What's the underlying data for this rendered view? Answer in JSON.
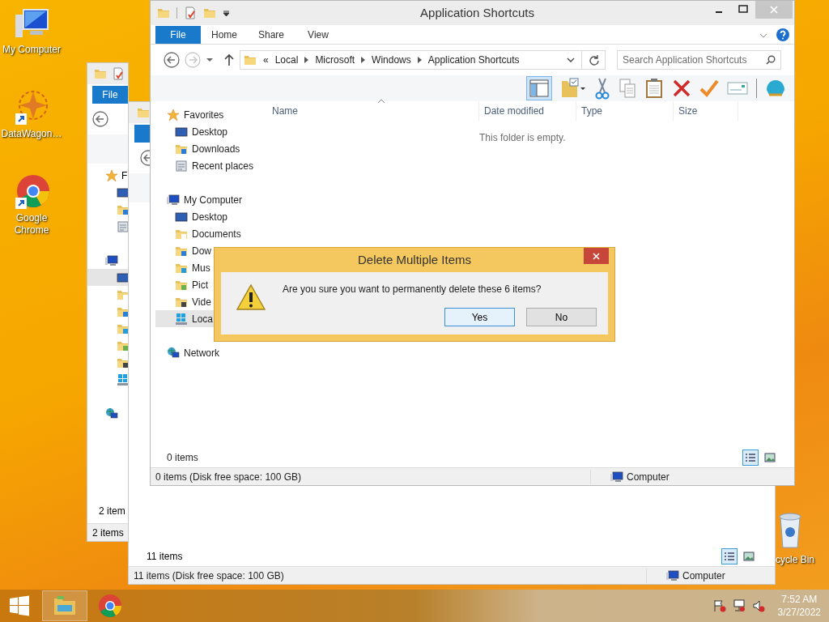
{
  "desktop_icons": [
    {
      "label": "My Computer",
      "kind": "computer"
    },
    {
      "label": "DataWagon…",
      "kind": "app"
    },
    {
      "label": "Google Chrome",
      "kind": "chrome"
    },
    {
      "label": "cycle Bin",
      "kind": "recycle"
    }
  ],
  "back_window": {
    "file_tab": "File",
    "sidebar": [
      {
        "kind": "star",
        "label": "F",
        "selected": false
      },
      {
        "kind": "desktop",
        "selected": false
      },
      {
        "kind": "download",
        "selected": false
      },
      {
        "kind": "recent",
        "selected": false
      },
      {
        "kind": "computer",
        "selected": false
      },
      {
        "kind": "desktop",
        "selected": true
      },
      {
        "kind": "documents",
        "selected": false
      },
      {
        "kind": "download",
        "selected": false
      },
      {
        "kind": "music",
        "selected": false
      },
      {
        "kind": "pictures",
        "selected": false
      },
      {
        "kind": "videos",
        "selected": false
      },
      {
        "kind": "drive",
        "selected": false
      },
      {
        "kind": "network",
        "selected": false
      }
    ],
    "item_count": "2 item",
    "status": "2 items"
  },
  "middle_window": {
    "item_count": "11 items",
    "status": "11 items (Disk free space: 100 GB)",
    "location": "Computer",
    "views": [
      {
        "kind": "details",
        "selected": true
      },
      {
        "kind": "tiles",
        "selected": false
      }
    ]
  },
  "explorer": {
    "title": "Application Shortcuts",
    "tabs": [
      {
        "label": "File",
        "selected": true
      },
      {
        "label": "Home",
        "selected": false
      },
      {
        "label": "Share",
        "selected": false
      },
      {
        "label": "View",
        "selected": false
      }
    ],
    "address": {
      "overflow_mark": "«",
      "crumbs": [
        "Local",
        "Microsoft",
        "Windows",
        "Application Shortcuts"
      ]
    },
    "search": {
      "placeholder": "Search Application Shortcuts"
    },
    "preview_pane": {
      "selected": true
    },
    "sidebar": [
      {
        "label": "Favorites",
        "kind": "star",
        "selected": false,
        "children": [
          {
            "label": "Desktop",
            "kind": "desktop",
            "selected": false
          },
          {
            "label": "Downloads",
            "kind": "download",
            "selected": false
          },
          {
            "label": "Recent places",
            "kind": "recent",
            "selected": false
          }
        ]
      },
      {
        "label": "My Computer",
        "kind": "computer",
        "selected": false,
        "children": [
          {
            "label": "Desktop",
            "kind": "desktop",
            "selected": false
          },
          {
            "label": "Documents",
            "kind": "documents",
            "selected": false
          },
          {
            "label": "Dow",
            "kind": "download",
            "selected": false
          },
          {
            "label": "Mus",
            "kind": "music",
            "selected": false
          },
          {
            "label": "Pict",
            "kind": "pictures",
            "selected": false
          },
          {
            "label": "Vide",
            "kind": "videos",
            "selected": false
          },
          {
            "label": "Loca",
            "kind": "drive",
            "selected": true
          }
        ]
      },
      {
        "label": "Network",
        "kind": "network",
        "selected": false
      }
    ],
    "columns": [
      "Name",
      "Date modified",
      "Type",
      "Size"
    ],
    "empty_message": "This folder is empty.",
    "item_count": "0 items",
    "status": "0 items (Disk free space: 100 GB)",
    "location": "Computer",
    "views": [
      {
        "kind": "details",
        "selected": true
      },
      {
        "kind": "tiles",
        "selected": false
      }
    ]
  },
  "dialog": {
    "title": "Delete Multiple Items",
    "message": "Are you sure you want to permanently delete these 6 items?",
    "buttons": [
      {
        "label": "Yes",
        "selected": true
      },
      {
        "label": "No",
        "selected": false
      }
    ]
  },
  "taskbar": {
    "apps": [
      {
        "kind": "explorer",
        "selected": true
      },
      {
        "kind": "chrome",
        "selected": false
      }
    ],
    "time": "7:52 AM",
    "date": "3/27/2022"
  }
}
